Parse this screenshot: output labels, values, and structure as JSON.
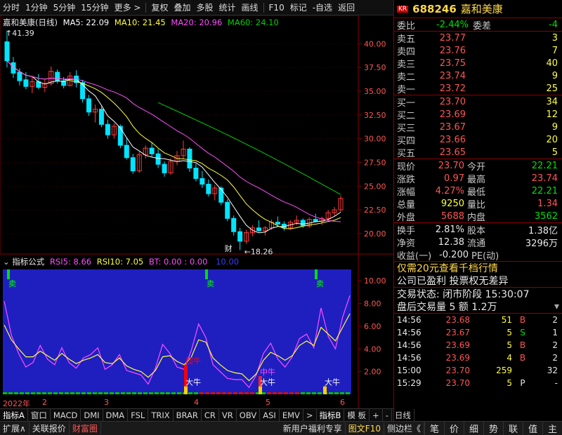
{
  "toolbar": {
    "items": [
      "分时",
      "1分钟",
      "5分钟",
      "15分钟",
      "更多 >",
      "复权",
      "叠加",
      "多股",
      "统计",
      "画线",
      "F10",
      "标记",
      "-自选",
      "返回"
    ]
  },
  "stock": {
    "badge": "KR",
    "code": "688246",
    "name": "嘉和美康"
  },
  "main_legend": {
    "title": "嘉和美康(日线)",
    "ma5": "MA5: 22.09",
    "ma10": "MA10: 21.45",
    "ma20": "MA20: 20.96",
    "ma60": "MA60: 24.10",
    "high_marker": "41.39",
    "low_marker": "18.26",
    "cai_label": "财"
  },
  "sub_legend": {
    "title": "指标公式",
    "rsi5": "RSI5: 8.66",
    "rsi10": "RSI10: 7.05",
    "bt": "BT: 0.00 : 0.00",
    "extra": "10.00"
  },
  "chart_data": [
    {
      "type": "candlestick",
      "title": "嘉和美康(日线)",
      "ylim": [
        18,
        41.5
      ],
      "yticks": [
        "40.00",
        "37.50",
        "35.00",
        "32.50",
        "30.00",
        "27.50",
        "25.00",
        "22.50",
        "20.00"
      ],
      "ohlc": [
        [
          40.2,
          41.39,
          37.5,
          38.2
        ],
        [
          38.0,
          38.6,
          36.4,
          36.9
        ],
        [
          37.0,
          37.4,
          35.6,
          36.1
        ],
        [
          36.2,
          37.0,
          35.2,
          35.5
        ],
        [
          35.5,
          36.6,
          34.8,
          36.0
        ],
        [
          36.0,
          36.8,
          35.2,
          35.4
        ],
        [
          35.4,
          36.2,
          34.9,
          35.8
        ],
        [
          35.8,
          37.6,
          35.6,
          37.1
        ],
        [
          37.0,
          37.3,
          35.8,
          36.1
        ],
        [
          36.1,
          36.5,
          35.3,
          35.6
        ],
        [
          35.6,
          37.0,
          35.5,
          36.6
        ],
        [
          36.6,
          37.2,
          35.4,
          35.9
        ],
        [
          35.9,
          36.2,
          33.8,
          34.2
        ],
        [
          34.2,
          34.6,
          32.4,
          32.8
        ],
        [
          32.8,
          33.6,
          31.7,
          33.1
        ],
        [
          33.1,
          33.4,
          31.2,
          31.5
        ],
        [
          31.5,
          32.0,
          30.0,
          30.4
        ],
        [
          30.4,
          31.6,
          30.0,
          31.3
        ],
        [
          31.3,
          31.5,
          29.0,
          29.3
        ],
        [
          29.3,
          30.1,
          27.8,
          28.0
        ],
        [
          28.0,
          28.4,
          26.3,
          26.6
        ],
        [
          26.6,
          28.6,
          26.4,
          28.3
        ],
        [
          28.3,
          29.3,
          27.9,
          29.0
        ],
        [
          29.0,
          29.6,
          28.1,
          28.4
        ],
        [
          28.4,
          28.9,
          26.9,
          27.3
        ],
        [
          27.3,
          27.6,
          26.0,
          26.4
        ],
        [
          26.4,
          27.9,
          26.2,
          27.6
        ],
        [
          27.6,
          28.7,
          27.2,
          28.2
        ],
        [
          28.2,
          29.8,
          27.9,
          28.9
        ],
        [
          28.9,
          29.1,
          26.5,
          26.9
        ],
        [
          26.9,
          27.4,
          25.5,
          25.8
        ],
        [
          25.8,
          26.6,
          24.8,
          25.2
        ],
        [
          25.2,
          25.7,
          23.9,
          24.2
        ],
        [
          24.2,
          25.1,
          23.5,
          24.8
        ],
        [
          24.8,
          25.0,
          23.0,
          23.3
        ],
        [
          23.3,
          23.6,
          21.3,
          21.6
        ],
        [
          21.6,
          21.9,
          19.8,
          20.2
        ],
        [
          20.2,
          20.6,
          18.26,
          19.2
        ],
        [
          19.2,
          20.4,
          18.9,
          20.1
        ],
        [
          20.1,
          20.9,
          19.7,
          20.6
        ],
        [
          20.6,
          21.4,
          20.2,
          20.3
        ],
        [
          20.3,
          20.8,
          19.8,
          20.6
        ],
        [
          20.6,
          21.5,
          20.4,
          21.2
        ],
        [
          21.2,
          21.8,
          20.8,
          21.0
        ],
        [
          21.0,
          21.3,
          20.3,
          20.6
        ],
        [
          20.6,
          21.4,
          20.4,
          21.2
        ],
        [
          21.2,
          21.9,
          20.9,
          21.4
        ],
        [
          21.4,
          21.6,
          20.6,
          20.8
        ],
        [
          20.8,
          21.7,
          20.6,
          21.5
        ],
        [
          21.5,
          22.1,
          21.2,
          21.3
        ],
        [
          21.3,
          21.8,
          20.9,
          21.6
        ],
        [
          21.6,
          22.5,
          21.4,
          22.2
        ],
        [
          22.2,
          22.8,
          21.9,
          22.5
        ],
        [
          22.5,
          24.0,
          22.3,
          23.7
        ]
      ],
      "series": [
        {
          "name": "MA5",
          "color": "#ffffff"
        },
        {
          "name": "MA10",
          "color": "#ffff3a"
        },
        {
          "name": "MA20",
          "color": "#ff4dff"
        },
        {
          "name": "MA60",
          "color": "#00d000"
        }
      ]
    },
    {
      "type": "line",
      "title": "指标公式",
      "ylim": [
        0,
        11
      ],
      "yticks": [
        "10.00",
        "8.00",
        "6.00",
        "4.00",
        "2.00"
      ],
      "series": [
        {
          "name": "RSI5",
          "color": "#ff4dff",
          "values": [
            8.2,
            5.2,
            3.6,
            2.4,
            2.8,
            4.3,
            3.1,
            2.6,
            4.1,
            2.8,
            2.3,
            3.2,
            3.5,
            4.1,
            2.2,
            2.6,
            3.5,
            2.1,
            1.9,
            1.7,
            0.9,
            2.3,
            4.4,
            3.6,
            2.4,
            2.2,
            3.9,
            6.2,
            5.0,
            2.6,
            2.0,
            1.4,
            1.3,
            1.3,
            0.6,
            1.7,
            3.6,
            4.5,
            3.1,
            2.4,
            3.3,
            4.9,
            5.3,
            4.1,
            7.6,
            5.1,
            4.0,
            6.8,
            8.7
          ]
        },
        {
          "name": "RSI10",
          "color": "#ffff3a",
          "values": [
            6.1,
            4.8,
            4.0,
            3.3,
            3.3,
            3.8,
            3.4,
            3.0,
            3.6,
            3.1,
            2.7,
            3.0,
            3.2,
            3.5,
            2.8,
            2.7,
            3.2,
            2.5,
            2.2,
            2.0,
            1.5,
            2.1,
            3.3,
            3.4,
            2.9,
            2.6,
            3.3,
            4.8,
            4.6,
            3.2,
            2.6,
            2.1,
            1.9,
            1.8,
            1.2,
            1.8,
            3.0,
            3.7,
            3.4,
            3.0,
            3.4,
            4.3,
            4.7,
            4.3,
            5.9,
            5.3,
            4.7,
            5.9,
            7.1
          ]
        }
      ],
      "signals": [
        {
          "label": "卖",
          "kind": "sell"
        },
        {
          "label": "卖",
          "kind": "sell"
        },
        {
          "label": "卖",
          "kind": "sell"
        },
        {
          "label": "超牛",
          "kind": "buy"
        },
        {
          "label": "大牛",
          "kind": "buy"
        },
        {
          "label": "中牛",
          "kind": "buy"
        },
        {
          "label": "大牛",
          "kind": "buy"
        },
        {
          "label": "大牛",
          "kind": "buy"
        }
      ]
    }
  ],
  "date_axis": {
    "labels": [
      "2022年",
      "2",
      "3",
      "4",
      "5",
      "6"
    ]
  },
  "tabs": [
    "指标A",
    "窗口",
    "MACD",
    "DMI",
    "DMA",
    "FSL",
    "TRIX",
    "BRAR",
    "CR",
    "VR",
    "OBV",
    "ASI",
    "EMV",
    ">",
    "指标B",
    "模 板",
    "+",
    "-",
    "日线"
  ],
  "quote": {
    "weibi_label": "委比",
    "weibi_value": "-2.44%",
    "weicha_label": "委差",
    "weicha_value": "-4",
    "asks": [
      {
        "label": "卖五",
        "price": "23.77",
        "vol": "3"
      },
      {
        "label": "卖四",
        "price": "23.76",
        "vol": "7"
      },
      {
        "label": "卖三",
        "price": "23.75",
        "vol": "40"
      },
      {
        "label": "卖二",
        "price": "23.74",
        "vol": "9"
      },
      {
        "label": "卖一",
        "price": "23.72",
        "vol": "25"
      }
    ],
    "bids": [
      {
        "label": "买一",
        "price": "23.70",
        "vol": "34"
      },
      {
        "label": "买二",
        "price": "23.69",
        "vol": "12"
      },
      {
        "label": "买三",
        "price": "23.67",
        "vol": "9"
      },
      {
        "label": "买四",
        "price": "23.66",
        "vol": "20"
      },
      {
        "label": "买五",
        "price": "23.65",
        "vol": "5"
      }
    ],
    "stats": [
      {
        "l1": "现价",
        "v1": "23.70",
        "c1": "red",
        "l2": "今开",
        "v2": "22.21",
        "c2": "green"
      },
      {
        "l1": "涨跌",
        "v1": "0.97",
        "c1": "red",
        "l2": "最高",
        "v2": "23.74",
        "c2": "red"
      },
      {
        "l1": "涨幅",
        "v1": "4.27%",
        "c1": "red",
        "l2": "最低",
        "v2": "22.21",
        "c2": "green"
      },
      {
        "l1": "总量",
        "v1": "9250",
        "c1": "yellow",
        "l2": "量比",
        "v2": "1.34",
        "c2": "red"
      },
      {
        "l1": "外盘",
        "v1": "5688",
        "c1": "red",
        "l2": "内盘",
        "v2": "3562",
        "c2": "green"
      }
    ],
    "stats2": [
      {
        "l1": "换手",
        "v1": "2.81%",
        "l2": "股本",
        "v2": "1.38亿"
      },
      {
        "l1": "净资",
        "v1": "12.38",
        "l2": "流通",
        "v2": "3296万"
      },
      {
        "l1": "收益(一)",
        "v1": "-0.200",
        "l2": "PE(动)",
        "v2": ""
      }
    ]
  },
  "ads": {
    "line1": "仅需20元查看千档行情",
    "line2": "公司已盈利 投票权无差异"
  },
  "trade_status": {
    "label": "交易状态: 闭市阶段 15:30:07",
    "after": "盘后交易量 5 额 1.2万"
  },
  "ticks": [
    {
      "time": "14:56",
      "price": "23.68",
      "vol": "51",
      "bs": "B",
      "bsc": "red",
      "n": "2"
    },
    {
      "time": "14:56",
      "price": "23.67",
      "vol": "5",
      "bs": "S",
      "bsc": "green",
      "n": "1"
    },
    {
      "time": "14:56",
      "price": "23.69",
      "vol": "5",
      "bs": "B",
      "bsc": "red",
      "n": "2"
    },
    {
      "time": "14:56",
      "price": "23.69",
      "vol": "4",
      "bs": "B",
      "bsc": "red",
      "n": "2"
    },
    {
      "time": "15:00",
      "price": "23.70",
      "vol": "259",
      "bs": "",
      "bsc": "white",
      "n": "32"
    },
    {
      "time": "15:29",
      "price": "23.70",
      "vol": "5",
      "bs": "P",
      "bsc": "white",
      "n": "-"
    }
  ],
  "bottom": {
    "left": [
      "扩展∧",
      "关联报价",
      "财富圈"
    ],
    "mid": [
      "新用户福利专享",
      "图文F10",
      "侧边栏《"
    ],
    "right": [
      "笔",
      "价",
      "细",
      "势",
      "联",
      "值",
      "主"
    ]
  }
}
